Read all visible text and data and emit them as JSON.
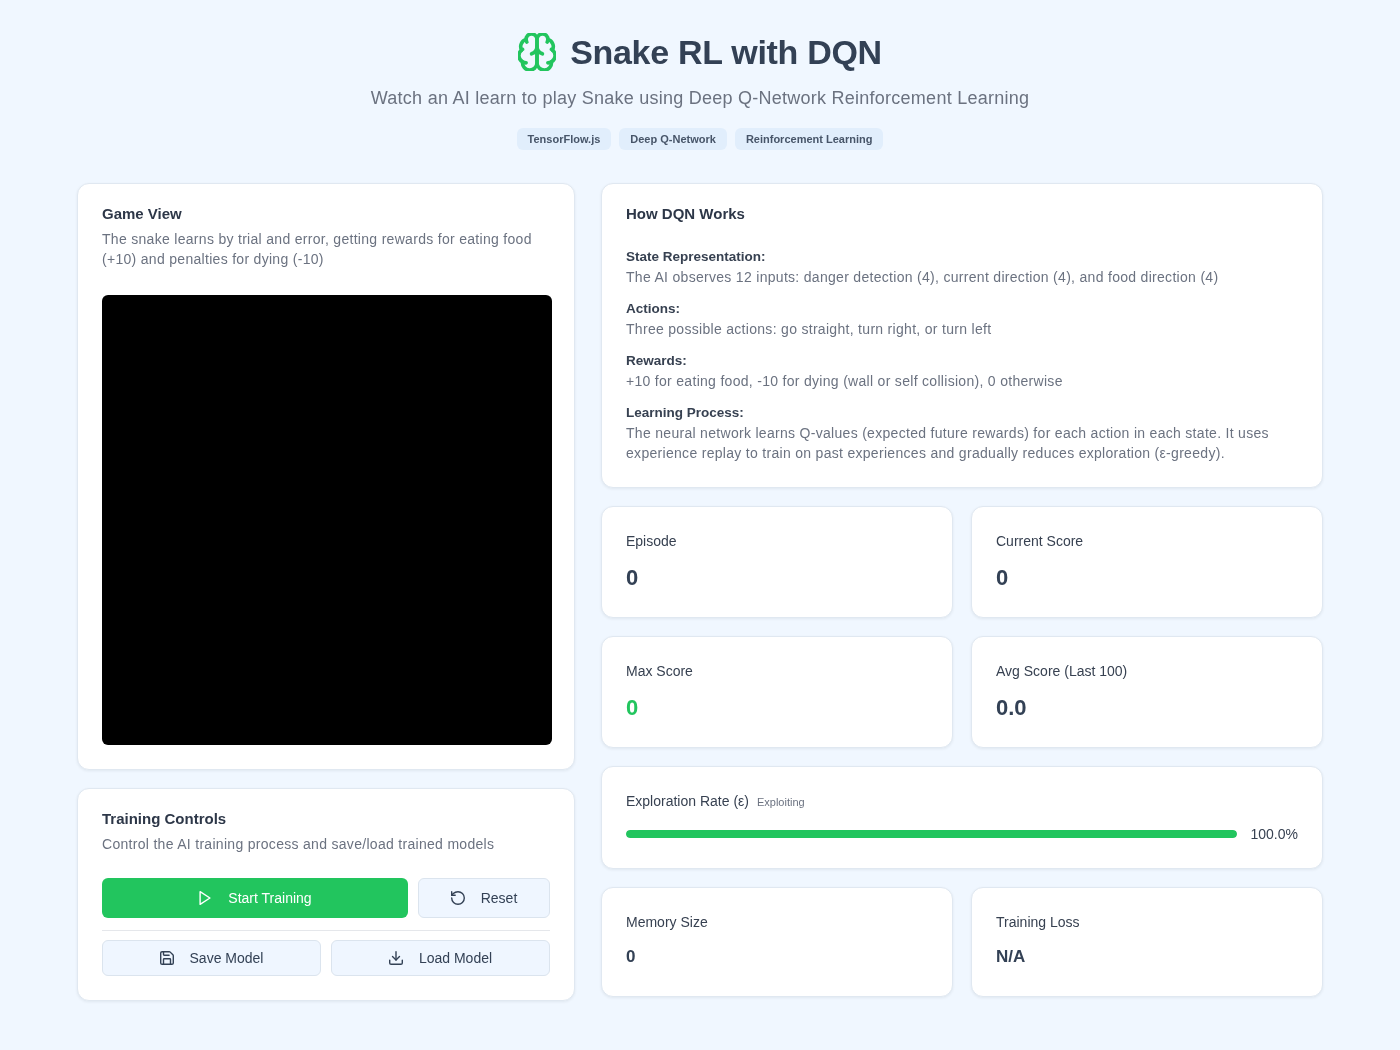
{
  "header": {
    "title": "Snake RL with DQN",
    "subtitle": "Watch an AI learn to play Snake using Deep Q-Network Reinforcement Learning",
    "badges": [
      "TensorFlow.js",
      "Deep Q-Network",
      "Reinforcement Learning"
    ]
  },
  "game_view": {
    "title": "Game View",
    "description": "The snake learns by trial and error, getting rewards for eating food (+10) and penalties for dying (-10)"
  },
  "training_controls": {
    "title": "Training Controls",
    "description": "Control the AI training process and save/load trained models",
    "buttons": [
      {
        "label": "Start Training",
        "kind": "primary"
      },
      {
        "label": "Reset",
        "kind": "secondary"
      }
    ],
    "model_buttons": [
      {
        "label": "Save Model"
      },
      {
        "label": "Load Model"
      }
    ]
  },
  "how_dqn_works": {
    "title": "How DQN Works",
    "sections": [
      {
        "heading": "State Representation:",
        "text": "The AI observes 12 inputs: danger detection (4), current direction (4), and food direction (4)"
      },
      {
        "heading": "Actions:",
        "text": "Three possible actions: go straight, turn right, or turn left"
      },
      {
        "heading": "Rewards:",
        "text": "+10 for eating food, -10 for dying (wall or self collision), 0 otherwise"
      },
      {
        "heading": "Learning Process:",
        "text": "The neural network learns Q-values (expected future rewards) for each action in each state. It uses experience replay to train on past experiences and gradually reduces exploration (ε-greedy)."
      }
    ]
  },
  "stats": [
    {
      "label": "Episode",
      "value": "0",
      "highlight": false
    },
    {
      "label": "Current Score",
      "value": "0",
      "highlight": false
    },
    {
      "label": "Max Score",
      "value": "0",
      "highlight": true
    },
    {
      "label": "Avg Score (Last 100)",
      "value": "0.0",
      "highlight": false
    }
  ],
  "exploration": {
    "label": "Exploration Rate (ε)",
    "status": "Exploiting",
    "level": 1,
    "reading": "100.0%"
  },
  "training_stats": [
    {
      "label": "Memory Size",
      "value": "0"
    },
    {
      "label": "Training Loss",
      "value": "N/A"
    }
  ]
}
